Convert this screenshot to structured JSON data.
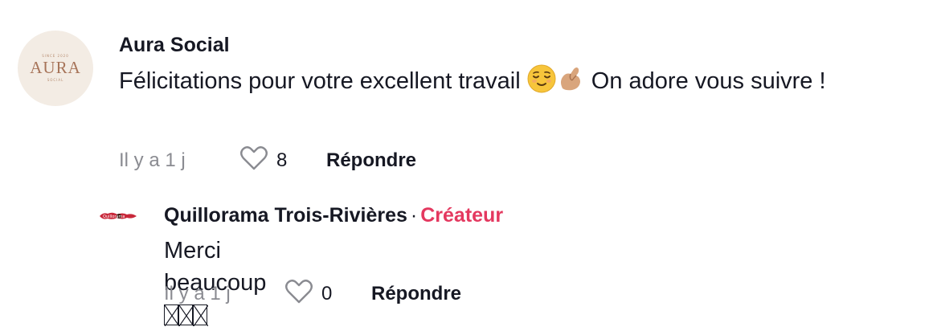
{
  "comment": {
    "avatar": {
      "brand_top": "SINCE 2020",
      "brand": "AURA",
      "brand_sub": "SOCIAL"
    },
    "username": "Aura Social",
    "text_part1": "Félicitations pour votre excellent travail ",
    "emoji1": "relieved-face",
    "emoji2": "pinching-hand",
    "text_part2": " On adore vous suivre !",
    "timestamp": "Il y a 1 j",
    "likes": "8",
    "reply_label": "Répondre"
  },
  "reply": {
    "avatar_label": "Quillorama",
    "username": "Quillorama Trois-Rivières",
    "separator": "·",
    "creator_badge": "Créateur",
    "text": "Merci beaucoup ",
    "timestamp": "Il y a 1 j",
    "likes": "0",
    "reply_label": "Répondre"
  },
  "colors": {
    "text": "#161823",
    "muted": "#8a8b91",
    "creator": "#e4385f",
    "avatar_bg": "#f3ece4",
    "avatar_brand": "#a77459"
  }
}
